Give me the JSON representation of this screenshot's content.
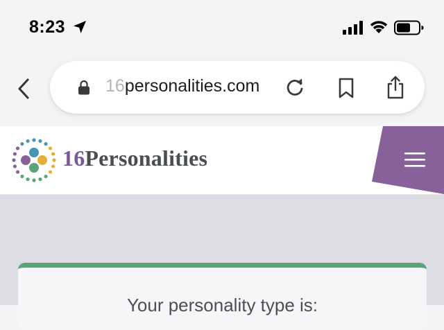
{
  "status_bar": {
    "time": "8:23",
    "icons": [
      "location-arrow-icon",
      "cellular-signal-icon",
      "wifi-icon",
      "battery-icon"
    ]
  },
  "browser": {
    "url_faded_prefix": "16",
    "url_main": "personalities.com",
    "icons": [
      "back-chevron-icon",
      "lock-icon",
      "reload-icon",
      "bookmark-icon",
      "share-icon"
    ]
  },
  "site": {
    "logo_number": "16",
    "logo_name": "Personalities",
    "menu_icon": "hamburger-menu-icon",
    "colors": {
      "brand_purple": "#88619a",
      "brand_green": "#57a478",
      "brand_teal": "#4298b4",
      "brand_yellow": "#e4ae3a"
    }
  },
  "content": {
    "result_heading": "Your personality type is:"
  }
}
